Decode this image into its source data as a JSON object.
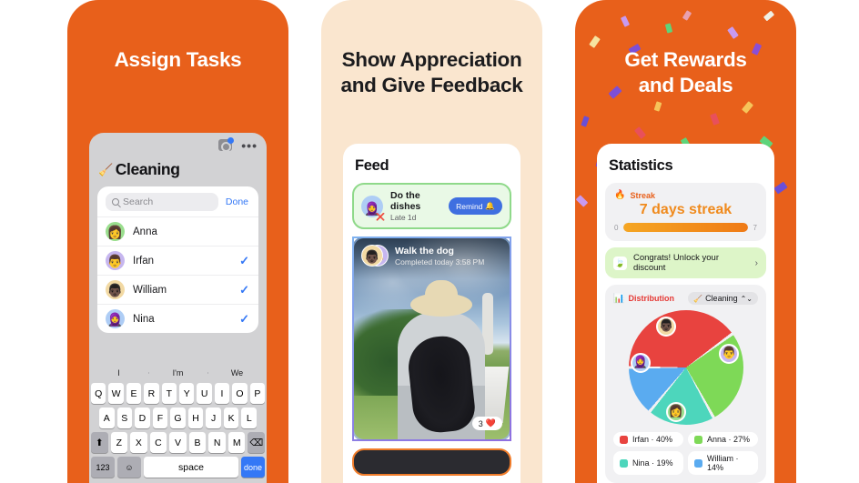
{
  "panels": [
    {
      "headline_lines": [
        "Assign Tasks"
      ],
      "bg": "#e8601b",
      "screen": {
        "title": "Cleaning",
        "title_icon": "broom-icon",
        "topbar_icons": [
          "camera-icon",
          "more-dots-icon"
        ],
        "search_placeholder": "Search",
        "done_label": "Done",
        "rows": [
          {
            "name": "Anna",
            "avatar": "green",
            "emoji": "👩",
            "checked": false
          },
          {
            "name": "Irfan",
            "avatar": "purple",
            "emoji": "👨",
            "checked": true
          },
          {
            "name": "William",
            "avatar": "tan",
            "emoji": "👨🏿",
            "checked": true
          },
          {
            "name": "Nina",
            "avatar": "blue",
            "emoji": "🧕",
            "checked": true
          }
        ],
        "check_mark": "✓",
        "keyboard": {
          "suggestions": [
            "I",
            "I'm",
            "We"
          ],
          "row1": [
            "Q",
            "W",
            "E",
            "R",
            "T",
            "Y",
            "U",
            "I",
            "O",
            "P"
          ],
          "row2": [
            "A",
            "S",
            "D",
            "F",
            "G",
            "H",
            "J",
            "K",
            "L"
          ],
          "row3": [
            "Z",
            "X",
            "C",
            "V",
            "B",
            "N",
            "M"
          ],
          "shift_label": "⬆",
          "backspace_label": "⌫",
          "numeric_label": "123",
          "emoji_label": "☺",
          "space_label": "space",
          "done_key_label": "done"
        }
      }
    },
    {
      "headline_lines": [
        "Show Appreciation",
        "and Give Feedback"
      ],
      "bg": "#fae6cf",
      "screen": {
        "title": "Feed",
        "cards": [
          {
            "type": "task",
            "title": "Do the dishes",
            "subtitle": "Late 1d",
            "avatar": "blue",
            "avatar_emoji": "🧕",
            "badge": "❌",
            "action_label": "Remind",
            "action_icon": "bell-icon",
            "border_color": "#8fd98a"
          },
          {
            "type": "photo",
            "title": "Walk the dog",
            "subtitle": "Completed today 3:58 PM",
            "avatars": [
              "tan",
              "purple"
            ],
            "avatar_emojis": [
              "👨🏿",
              "👨"
            ],
            "likes_count": "3",
            "likes_icon": "❤️"
          },
          {
            "type": "partial",
            "border_color": "#f07c2a"
          }
        ]
      }
    },
    {
      "headline_lines": [
        "Get Rewards",
        "and Deals"
      ],
      "bg": "#e8601b",
      "screen": {
        "title": "Statistics",
        "streak": {
          "icon": "flame-icon",
          "label": "Streak",
          "value_text": "7 days streak",
          "bar_min": "0",
          "bar_max": "7",
          "progress_pct": 100
        },
        "deal": {
          "icon": "leaf-icon",
          "text": "Congrats!  Unlock your discount",
          "chevron": "›"
        },
        "distribution": {
          "icon": "chart-icon",
          "label": "Distribution",
          "selector_label": "Cleaning",
          "selector_icon": "chevron-updown-icon",
          "selector_prefix": "🧹"
        }
      }
    }
  ],
  "chart_data": {
    "type": "pie",
    "title": "Distribution",
    "subtitle": "Cleaning",
    "categories": [
      "Irfan",
      "Anna",
      "Nina",
      "William"
    ],
    "values": [
      40,
      27,
      19,
      14
    ],
    "unit": "%",
    "colors": [
      "#e8433f",
      "#7ed957",
      "#4dd6bc",
      "#5aabf0"
    ],
    "legend_position": "bottom",
    "legend": [
      {
        "label": "Irfan · 40%",
        "color": "#e8433f",
        "avatar": "purple",
        "emoji": "👨"
      },
      {
        "label": "Anna · 27%",
        "color": "#7ed957",
        "avatar": "green",
        "emoji": "👩"
      },
      {
        "label": "Nina · 19%",
        "color": "#4dd6bc",
        "avatar": "blue",
        "emoji": "🧕"
      },
      {
        "label": "William · 14%",
        "color": "#5aabf0",
        "avatar": "tan",
        "emoji": "👨🏿"
      }
    ]
  }
}
